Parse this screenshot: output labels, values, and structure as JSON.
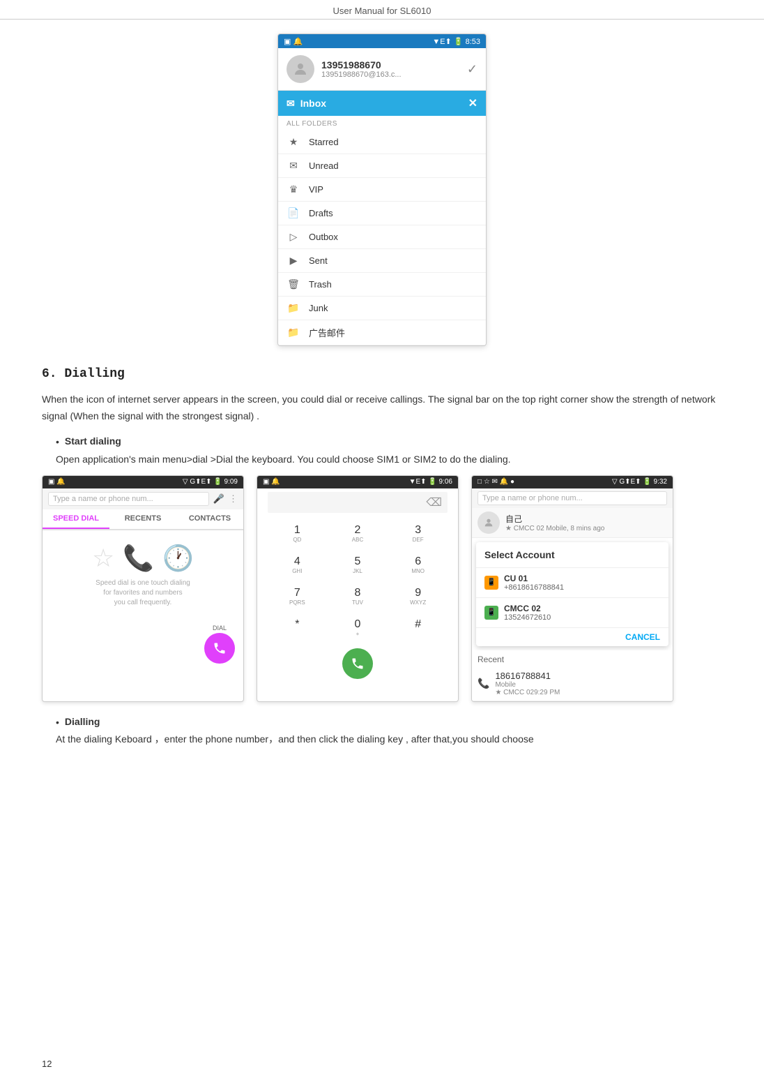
{
  "page": {
    "header": "User Manual for SL6010",
    "page_number": "12"
  },
  "email_app": {
    "status_bar": {
      "left_icons": "▣ 🔔",
      "right": "▼E⬆ 🔋 8:53"
    },
    "contact": {
      "name": "13951988670",
      "email": "13951988670@163.c..."
    },
    "inbox_tab": "Inbox",
    "folders_label": "ALL FOLDERS",
    "folders": [
      {
        "icon": "★",
        "label": "Starred"
      },
      {
        "icon": "✉",
        "label": "Unread"
      },
      {
        "icon": "👑",
        "label": "VIP"
      },
      {
        "icon": "📄",
        "label": "Drafts"
      },
      {
        "icon": "📤",
        "label": "Outbox"
      },
      {
        "icon": "▶",
        "label": "Sent"
      },
      {
        "icon": "🗑",
        "label": "Trash"
      },
      {
        "icon": "📁",
        "label": "Junk"
      },
      {
        "icon": "📁",
        "label": "广告邮件"
      }
    ]
  },
  "section6": {
    "title": "6. Dialling",
    "body": "When the icon of internet server appears in the screen, you could dial or receive callings. The signal bar on the top right corner show the strength of network signal (When the signal with the strongest signal) .",
    "bullets": [
      {
        "label": "Start dialing",
        "sub_text": "Open application's main menu>dial >Dial the keyboard. You could choose SIM1 or SIM2 to do the dialing."
      }
    ],
    "dialer1": {
      "status_left": "▣ 🔔",
      "status_right": "▽ G⬆E⬆ 🔋 9:09",
      "search_placeholder": "Type a name or phone num...",
      "tabs": [
        "SPEED DIAL",
        "RECENTS",
        "CONTACTS"
      ],
      "active_tab": "SPEED DIAL",
      "speed_dial_icon": "☆",
      "speed_dial_text": "Speed dial is one touch dialing\nfor favorites and numbers\nyou call frequently.",
      "dial_label": "DIAL"
    },
    "dialer2": {
      "status_left": "▣ 🔔",
      "status_right": "▼E⬆ 🔋 9:06",
      "keys": [
        {
          "num": "1",
          "letters": "QD"
        },
        {
          "num": "2",
          "letters": "ABC"
        },
        {
          "num": "3",
          "letters": "DEF"
        },
        {
          "num": "4",
          "letters": "GHI"
        },
        {
          "num": "5",
          "letters": "JKL"
        },
        {
          "num": "6",
          "letters": "MNO"
        },
        {
          "num": "7",
          "letters": "PQRS"
        },
        {
          "num": "8",
          "letters": "TUV"
        },
        {
          "num": "9",
          "letters": "WXYZ"
        },
        {
          "num": "*",
          "letters": ""
        },
        {
          "num": "0",
          "letters": "+"
        },
        {
          "num": "#",
          "letters": ""
        }
      ]
    },
    "dialer3": {
      "status_left": "□ ☆ ✉ 🔔 ●",
      "status_right": "▽ G⬆E⬆ 🔋 9:32",
      "search_placeholder": "Type a name or phone num...",
      "contact_name": "自己",
      "contact_sub": "★ CMCC 02 Mobile, 8 mins ago",
      "dialog_title": "Select Account",
      "accounts": [
        {
          "icon": "📱",
          "color": "orange",
          "name": "CU 01",
          "number": "+8618616788841"
        },
        {
          "icon": "📱",
          "color": "green",
          "name": "CMCC 02",
          "number": "13524672610"
        }
      ],
      "cancel_label": "CANCEL",
      "recent_section": "Recent",
      "recent_call": {
        "number": "18616788841",
        "type": "Mobile",
        "sub": "★ CMCC 029:29 PM"
      }
    },
    "bottom_bullets": [
      {
        "label": "Dialling",
        "sub_text": "At the dialing Keboard ，enter the phone number，and then click the dialing key , after that,you should choose"
      }
    ]
  }
}
